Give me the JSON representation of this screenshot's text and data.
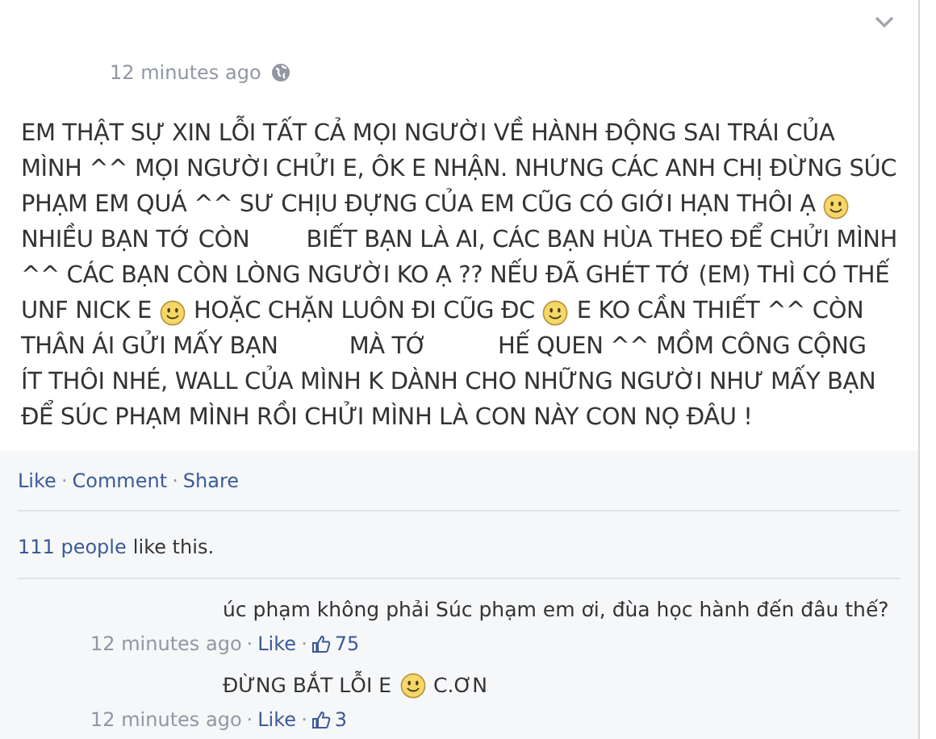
{
  "post": {
    "time": "12 minutes ago",
    "lines": [
      [
        {
          "kind": "text",
          "text": "EM THẬT SỰ XIN LỖI TẤT CẢ MỌI NGƯỜI VỀ HÀNH ĐỘNG SAI TRÁI CỦA"
        }
      ],
      [
        {
          "kind": "text",
          "text": "MÌNH ^^ MỌI NGƯỜI CHỬI E, ÔK E NHẬN. NHƯNG CÁC ANH CHỊ ĐỪNG SÚC"
        }
      ],
      [
        {
          "kind": "text",
          "text": "PHẠM EM QUÁ ^^ SƯ CHỊU ĐỰNG CỦA EM CŨG CÓ GIỚI HẠN THÔI Ạ"
        },
        {
          "kind": "smiley"
        }
      ],
      [
        {
          "kind": "text",
          "text": "NHIỀU BẠN TỚ CÒN"
        },
        {
          "kind": "redacted"
        },
        {
          "kind": "text",
          "text": "BIẾT BẠN LÀ AI, CÁC BẠN HÙA THEO ĐỂ CHỬI MÌNH"
        }
      ],
      [
        {
          "kind": "text",
          "text": "^^ CÁC BẠN CÒN LÒNG NGƯỜI KO Ạ ?? NẾU ĐÃ GHÉT TỚ (EM) THÌ CÓ THẾ"
        }
      ],
      [
        {
          "kind": "text",
          "text": "UNF NICK E"
        },
        {
          "kind": "smiley"
        },
        {
          "kind": "text",
          "text": "HOẶC CHẶN LUÔN ĐI CŨG ĐC"
        },
        {
          "kind": "smiley"
        },
        {
          "kind": "text",
          "text": "E KO CẦN THIẾT ^^ CÒN"
        }
      ],
      [
        {
          "kind": "text",
          "text": "THÂN ÁI GỬI MẤY BẠN"
        },
        {
          "kind": "redacted"
        },
        {
          "kind": "text",
          "text": "MÀ TỚ"
        },
        {
          "kind": "redacted"
        },
        {
          "kind": "text",
          "text": "HẾ QUEN ^^ MỒM CÔNG CỘNG"
        }
      ],
      [
        {
          "kind": "text",
          "text": "ÍT THÔI NHÉ, WALL CỦA MÌNH K DÀNH CHO NHỮNG NGƯỜI NHƯ MẤY BẠN"
        }
      ],
      [
        {
          "kind": "text",
          "text": "ĐỂ SÚC PHẠM MÌNH RỒI CHỬI MÌNH LÀ CON NÀY CON NỌ ĐÂU !"
        }
      ]
    ],
    "actions": [
      "Like",
      "Comment",
      "Share"
    ],
    "separator": "·",
    "likes": {
      "count": "111 people",
      "suffix": "like this."
    }
  },
  "comments": [
    {
      "lines": [
        {
          "kind": "text",
          "text": "úc phạm không phải Súc phạm em ơi, đùa học hành đến đâu thế?"
        }
      ],
      "time": "12 minutes ago",
      "separator": "·",
      "like": "Like",
      "likes": "75"
    },
    {
      "lines": [
        {
          "kind": "text",
          "text": "ĐỪNG BẮT LỖI E"
        },
        {
          "kind": "smiley"
        },
        {
          "kind": "text",
          "text": "C.ƠN"
        }
      ],
      "time": "12 minutes ago",
      "separator": "·",
      "like": "Like",
      "likes": "3"
    }
  ]
}
